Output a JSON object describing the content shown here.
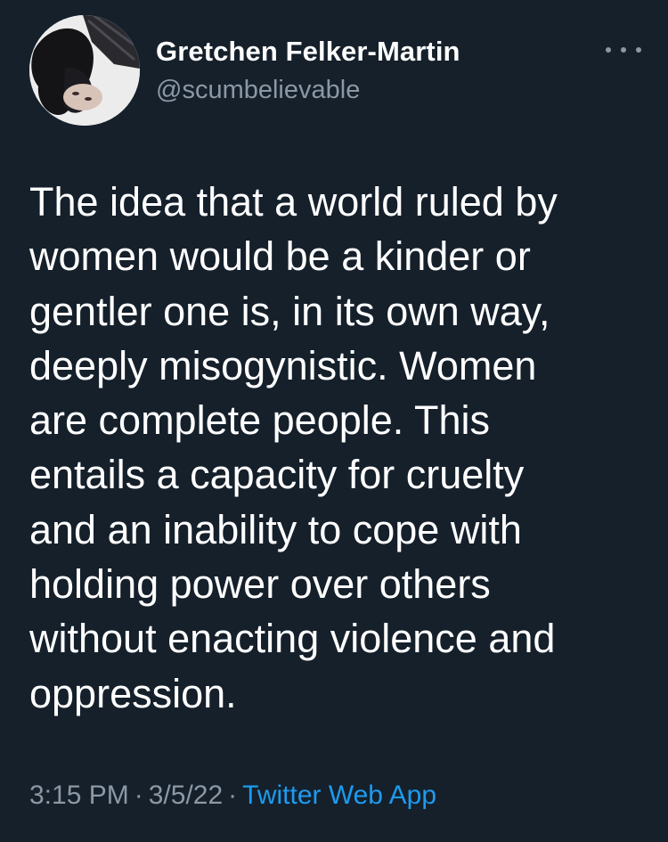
{
  "author": {
    "display_name": "Gretchen Felker-Martin",
    "handle": "@scumbelievable"
  },
  "more_icon": "more-horizontal-icon",
  "tweet_lines": [
    "The idea that a world ruled by",
    "women would be a kinder or",
    "gentler one is, in its own way,",
    "deeply misogynistic. Women",
    "are complete people. This",
    "entails a capacity for cruelty",
    "and an inability to cope with",
    "holding power over others",
    "without enacting violence and",
    "oppression."
  ],
  "meta": {
    "time": "3:15 PM",
    "separator": "·",
    "date": "3/5/22",
    "source": "Twitter Web App"
  },
  "colors": {
    "background": "#15202b",
    "text": "#ffffff",
    "secondary": "#8b98a5",
    "link": "#1d9bf0"
  }
}
